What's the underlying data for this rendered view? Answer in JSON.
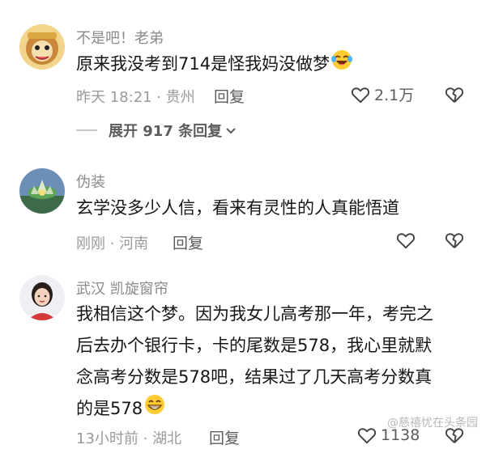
{
  "comments": [
    {
      "username": "不是吧！老弟",
      "lines": [
        "原来我没考到714是怪我妈没做梦"
      ],
      "emoji": "laughing-crying-emoji",
      "time_location": "昨天 18:21 · 贵州",
      "reply_label": "回复",
      "like_count": "2.1万",
      "expand_label": "展开 917 条回复"
    },
    {
      "username": "伪装",
      "lines": [
        "玄学没多少人信，看来有灵性的人真能悟道"
      ],
      "time_location": "刚刚 · 河南",
      "reply_label": "回复",
      "like_count": ""
    },
    {
      "username": "武汉  凯旋窗帘",
      "lines": [
        "我相信这个梦。因为我女儿高考那一年，考完之",
        "后去办个银行卡，卡的尾数是578，我心里就默",
        "念高考分数是578吧，结果过了几天高考分数真",
        "的是578"
      ],
      "emoji": "grinning-emoji",
      "time_location": "13小时前 · 湖北",
      "reply_label": "回复",
      "like_count": "1138"
    }
  ],
  "watermark": "@慈禧忧在头条园",
  "colors": {
    "meta": "#9a9a9a",
    "text": "#161616",
    "username": "#8a8a8a"
  }
}
